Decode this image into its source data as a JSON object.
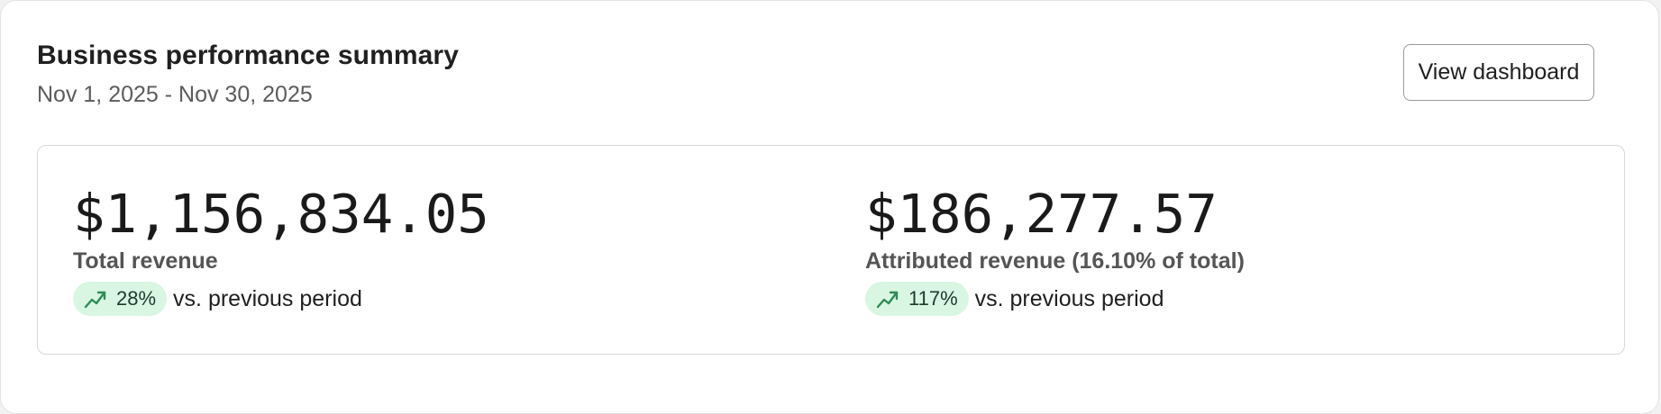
{
  "header": {
    "title": "Business performance summary",
    "date_range": "Nov 1, 2025 - Nov 30, 2025",
    "view_button_label": "View dashboard"
  },
  "metrics": [
    {
      "value": "$1,156,834.05",
      "label": "Total revenue",
      "trend_percent": "28%",
      "trend_direction": "up",
      "trend_icon": "trending-up-icon",
      "comparison_text": "vs. previous period"
    },
    {
      "value": "$186,277.57",
      "label": "Attributed revenue (16.10% of total)",
      "trend_percent": "117%",
      "trend_direction": "up",
      "trend_icon": "trending-up-icon",
      "comparison_text": "vs. previous period"
    }
  ],
  "colors": {
    "badge_background": "#d8f6e2",
    "trend_icon": "#2e8b57"
  }
}
